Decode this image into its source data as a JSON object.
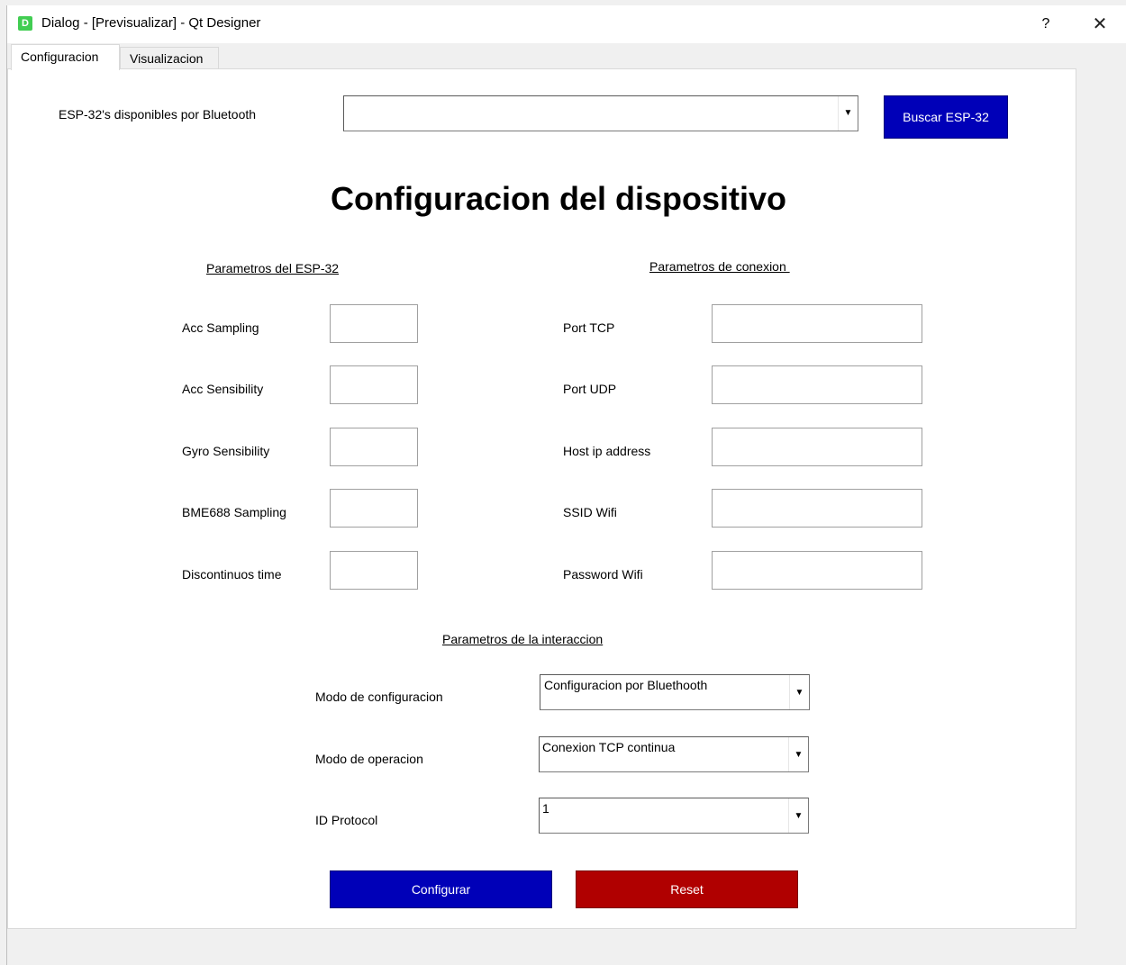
{
  "window": {
    "icon_letter": "D",
    "title": "Dialog - [Previsualizar] - Qt Designer",
    "help_label": "?",
    "close_label": "✕"
  },
  "tabs": [
    {
      "label": "Configuracion",
      "selected": true
    },
    {
      "label": "Visualizacion",
      "selected": false
    }
  ],
  "bluetooth": {
    "label": "ESP-32's disponibles por Bluetooth",
    "combo_value": "",
    "search_button": "Buscar ESP-32"
  },
  "title": "Configuracion del dispositivo",
  "esp_section": {
    "header": "Parametros del ESP-32",
    "fields": [
      {
        "label": "Acc Sampling",
        "value": ""
      },
      {
        "label": "Acc Sensibility",
        "value": ""
      },
      {
        "label": "Gyro Sensibility",
        "value": ""
      },
      {
        "label": "BME688 Sampling",
        "value": ""
      },
      {
        "label": "Discontinuos time",
        "value": ""
      }
    ]
  },
  "conn_section": {
    "header": "Parametros de conexion ",
    "fields": [
      {
        "label": "Port TCP",
        "value": ""
      },
      {
        "label": "Port UDP",
        "value": ""
      },
      {
        "label": "Host ip address",
        "value": ""
      },
      {
        "label": "SSID Wifi",
        "value": ""
      },
      {
        "label": "Password Wifi",
        "value": ""
      }
    ]
  },
  "interaction_section": {
    "header": "Parametros de la interaccion",
    "config_mode": {
      "label": "Modo de configuracion",
      "value": "Configuracion por Bluethooth"
    },
    "operation_mode": {
      "label": "Modo de operacion",
      "value": "Conexion TCP continua"
    },
    "protocol": {
      "label": "ID Protocol",
      "value": "1"
    }
  },
  "actions": {
    "configure": "Configurar",
    "reset": "Reset"
  },
  "colors": {
    "blue_button": "#0000b8",
    "red_button": "#b00000",
    "qt_green": "#41cd52"
  }
}
